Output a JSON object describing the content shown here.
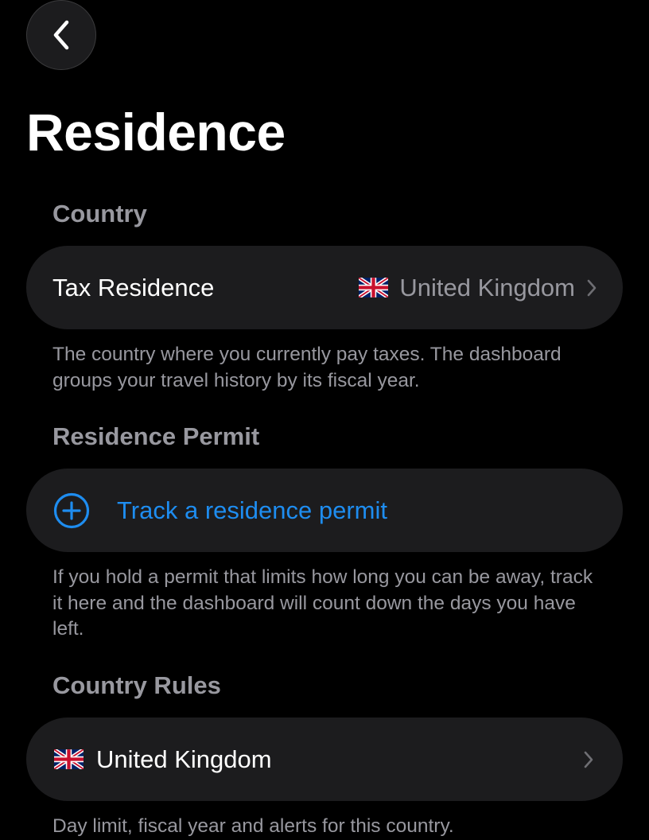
{
  "nav": {
    "back_icon": "chevron-left-icon"
  },
  "page": {
    "title": "Residence"
  },
  "sections": {
    "country": {
      "header": "Country",
      "row_label": "Tax Residence",
      "row_value": "United Kingdom",
      "flag_icon": "uk-flag-icon",
      "footer": "The country where you currently pay taxes. The dashboard groups your travel history by its fiscal year."
    },
    "residence_permit": {
      "header": "Residence Permit",
      "action_label": "Track a residence permit",
      "action_icon": "plus-circle-icon",
      "footer": "If you hold a permit that limits how long you can be away, track it here and the dashboard will count down the days you have left."
    },
    "country_rules": {
      "header": "Country Rules",
      "row_label": "United Kingdom",
      "flag_icon": "uk-flag-icon",
      "footer": "Day limit, fiscal year and alerts for this country."
    }
  },
  "colors": {
    "background": "#000000",
    "card": "#1c1c1e",
    "secondary_text": "#98989f",
    "accent": "#1e8df0"
  }
}
